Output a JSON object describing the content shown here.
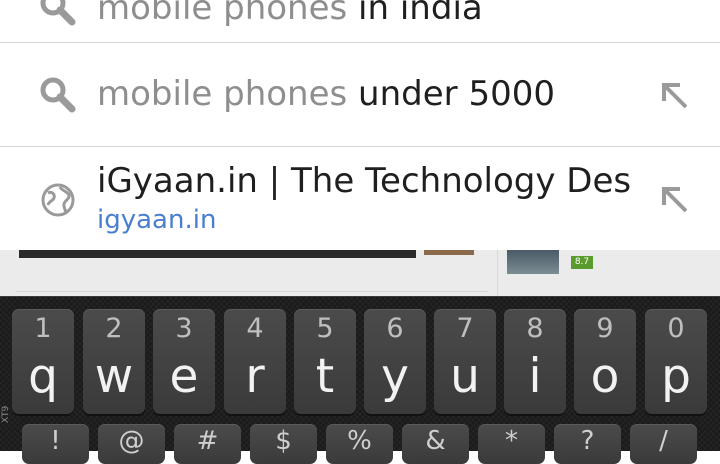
{
  "suggestions": [
    {
      "prefix": "mobile phones",
      "suffix": " in india",
      "icon": "search-icon"
    },
    {
      "prefix": "mobile phones",
      "suffix": " under 5000",
      "icon": "search-icon"
    },
    {
      "title": "iGyaan.in | The Technology Destir",
      "url": "igyaan.in",
      "icon": "globe-icon"
    }
  ],
  "background_page": {
    "badge": "8.7"
  },
  "keyboard": {
    "keys": [
      {
        "num": "1",
        "letter": "q"
      },
      {
        "num": "2",
        "letter": "w"
      },
      {
        "num": "3",
        "letter": "e"
      },
      {
        "num": "4",
        "letter": "r"
      },
      {
        "num": "5",
        "letter": "t"
      },
      {
        "num": "6",
        "letter": "y"
      },
      {
        "num": "7",
        "letter": "u"
      },
      {
        "num": "8",
        "letter": "i"
      },
      {
        "num": "9",
        "letter": "o"
      },
      {
        "num": "0",
        "letter": "p"
      }
    ],
    "second_row_symbols": [
      "!",
      "@",
      "#",
      "$",
      "%",
      "&",
      "*",
      "?",
      "/"
    ],
    "side_label": "XT9"
  },
  "colors": {
    "link": "#4a7fd0",
    "muted": "#8e8e8e",
    "keyboard_bg": "#1b1b1b"
  }
}
